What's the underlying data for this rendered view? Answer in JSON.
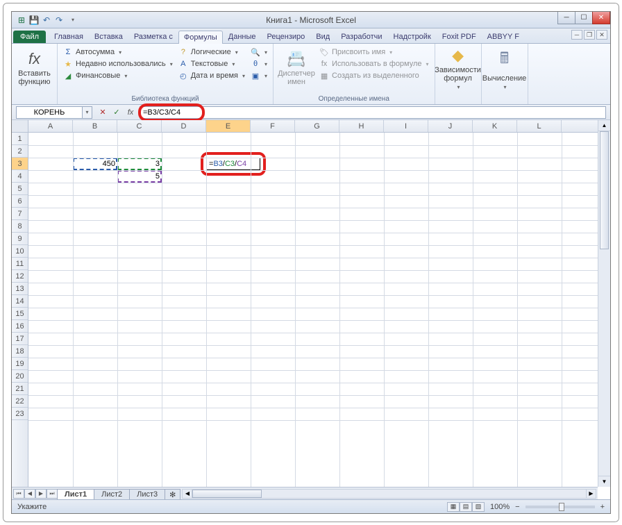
{
  "window": {
    "title": "Книга1 - Microsoft Excel"
  },
  "qat": {
    "save": "💾",
    "undo": "↶",
    "redo": "↷"
  },
  "tabs": {
    "file": "Файл",
    "items": [
      "Главная",
      "Вставка",
      "Разметка с",
      "Формулы",
      "Данные",
      "Рецензиро",
      "Вид",
      "Разработчи",
      "Надстройк",
      "Foxit PDF",
      "ABBYY F"
    ],
    "active_index": 3
  },
  "ribbon": {
    "insert_fn": {
      "label": "Вставить\nфункцию",
      "icon": "fx"
    },
    "lib": {
      "autosum": "Автосумма",
      "recent": "Недавно использовались",
      "financial": "Финансовые",
      "logical": "Логические",
      "text": "Текстовые",
      "datetime": "Дата и время",
      "group_label": "Библиотека функций"
    },
    "names": {
      "manager": "Диспетчер\nимен",
      "assign": "Присвоить имя",
      "use": "Использовать в формуле",
      "create": "Создать из выделенного",
      "group_label": "Определенные имена"
    },
    "deps": {
      "label": "Зависимости\nформул"
    },
    "calc": {
      "label": "Вычисление"
    }
  },
  "namebox": "КОРЕНЬ",
  "formula_bar": "=B3/C3/C4",
  "columns": [
    "A",
    "B",
    "C",
    "D",
    "E",
    "F",
    "G",
    "H",
    "I",
    "J",
    "K",
    "L"
  ],
  "rows_count": 23,
  "cell_data": {
    "B3": "450",
    "C3": "3",
    "C4": "5",
    "E3_formula": "=B3/C3/C4"
  },
  "sheets": {
    "items": [
      "Лист1",
      "Лист2",
      "Лист3"
    ],
    "active_index": 0
  },
  "status": {
    "left": "Укажите",
    "zoom": "100%",
    "minus": "−",
    "plus": "+"
  }
}
